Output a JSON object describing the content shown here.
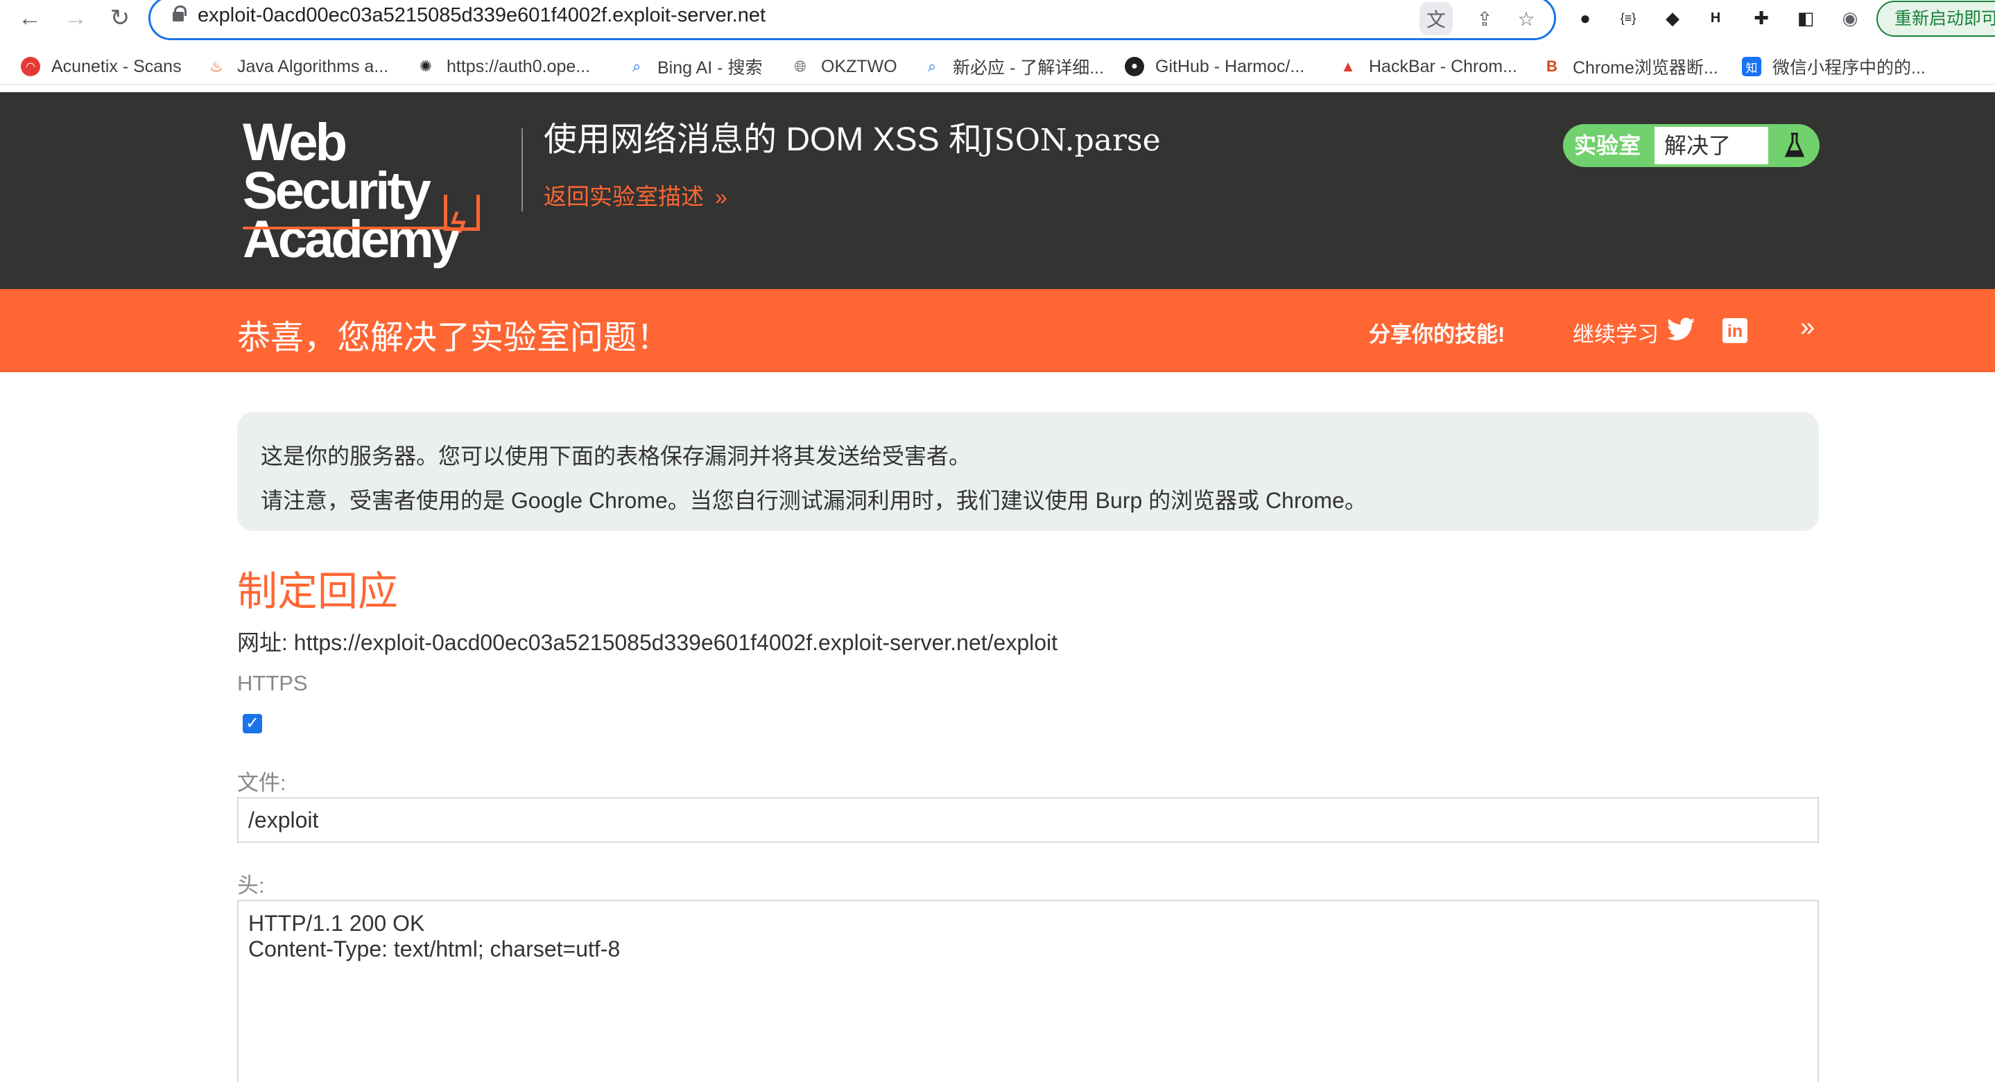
{
  "browser": {
    "url": "exploit-0acd00ec03a5215085d339e601f4002f.exploit-server.net",
    "restart_label": "重新启动即可",
    "bookmarks": [
      {
        "label": "Acunetix - Scans",
        "icon": "acunetix-icon"
      },
      {
        "label": "Java Algorithms a...",
        "icon": "java-icon"
      },
      {
        "label": "https://auth0.ope...",
        "icon": "openai-icon"
      },
      {
        "label": "Bing AI - 搜索",
        "icon": "search-icon"
      },
      {
        "label": "OKZTWO",
        "icon": "globe-icon"
      },
      {
        "label": "新必应 - 了解详细...",
        "icon": "search-icon"
      },
      {
        "label": "GitHub - Harmoc/...",
        "icon": "github-icon"
      },
      {
        "label": "HackBar - Chrom...",
        "icon": "chrome-store-icon"
      },
      {
        "label": "Chrome浏览器断...",
        "icon": "b-logo-icon"
      },
      {
        "label": "微信小程序中的的...",
        "icon": "zhihu-icon"
      }
    ]
  },
  "header": {
    "logo_line1": "Web Security",
    "logo_line2": "Academy",
    "title_prefix": "使用网络消息的 DOM XSS 和",
    "title_code": "JSON.parse",
    "back_link": "返回实验室描述",
    "status_label": "实验室",
    "status_value": "解决了"
  },
  "notification": {
    "message": "恭喜，您解决了实验室问题！",
    "share": "分享你的技能!",
    "learn": "继续学习"
  },
  "info": {
    "line1": "这是你的服务器。您可以使用下面的表格保存漏洞并将其发送给受害者。",
    "line2": "请注意，受害者使用的是 Google Chrome。当您自行测试漏洞利用时，我们建议使用 Burp 的浏览器或 Chrome。"
  },
  "form": {
    "title": "制定回应",
    "url_label": "网址:",
    "url_value": "https://exploit-0acd00ec03a5215085d339e601f4002f.exploit-server.net/exploit",
    "https_label": "HTTPS",
    "https_checked": true,
    "file_label": "文件:",
    "file_value": "/exploit",
    "head_label": "头:",
    "head_value": "HTTP/1.1 200 OK\nContent-Type: text/html; charset=utf-8"
  },
  "colors": {
    "accent": "#ff6633",
    "header_bg": "#333332",
    "solved_green": "#70d16d",
    "info_bg": "#ebeff0",
    "focus_blue": "#1a73e8"
  }
}
